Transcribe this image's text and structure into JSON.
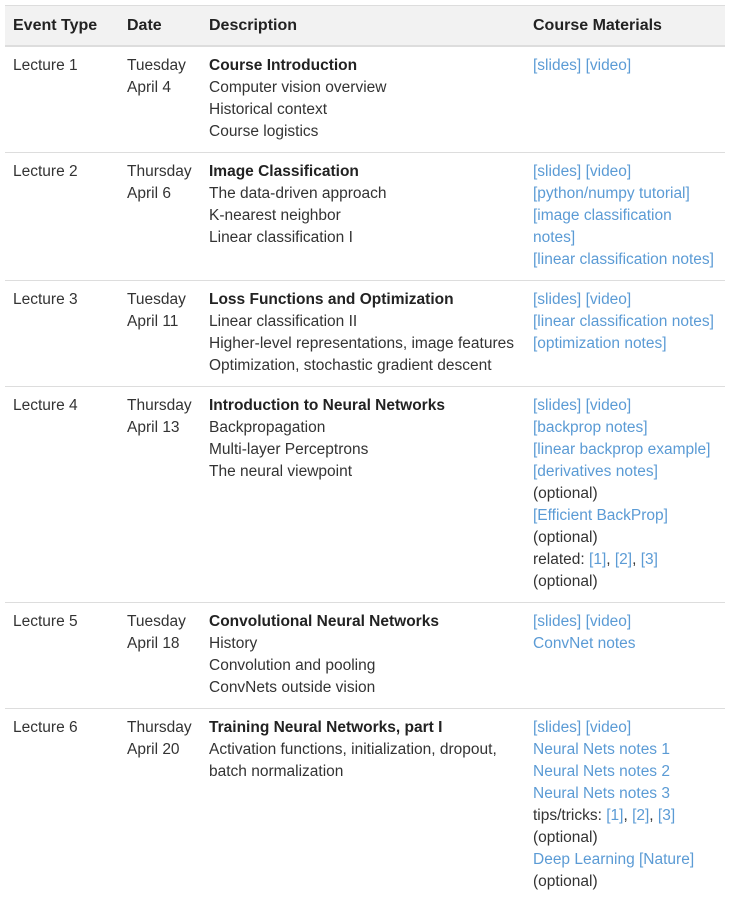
{
  "headers": {
    "event_type": "Event Type",
    "date": "Date",
    "description": "Description",
    "materials": "Course Materials"
  },
  "rows": [
    {
      "event": "Lecture 1",
      "date_line1": "Tuesday",
      "date_line2": "April 4",
      "title": "Course Introduction",
      "topics": [
        "Computer vision overview",
        "Historical context",
        "Course logistics"
      ],
      "materials": {
        "slides": "[slides]",
        "video": "[video]"
      }
    },
    {
      "event": "Lecture 2",
      "date_line1": "Thursday",
      "date_line2": "April 6",
      "title": "Image Classification",
      "topics": [
        "The data-driven approach",
        "K-nearest neighbor",
        "Linear classification I"
      ],
      "materials": {
        "slides": "[slides]",
        "video": "[video]",
        "python_tutorial": "[python/numpy tutorial]",
        "image_classification_notes": "[image classification notes]",
        "linear_classification_notes": "[linear classification notes]"
      }
    },
    {
      "event": "Lecture 3",
      "date_line1": "Tuesday",
      "date_line2": "April 11",
      "title": "Loss Functions and Optimization",
      "topics": [
        "Linear classification II",
        "Higher-level representations, image features",
        "Optimization, stochastic gradient descent"
      ],
      "materials": {
        "slides": "[slides]",
        "video": "[video]",
        "linear_classification_notes": "[linear classification notes]",
        "optimization_notes": "[optimization notes]"
      }
    },
    {
      "event": "Lecture 4",
      "date_line1": "Thursday",
      "date_line2": "April 13",
      "title": "Introduction to Neural Networks",
      "topics": [
        "Backpropagation",
        "Multi-layer Perceptrons",
        "The neural viewpoint"
      ],
      "materials": {
        "slides": "[slides]",
        "video": "[video]",
        "backprop_notes": "[backprop notes]",
        "linear_backprop_example": "[linear backprop example]",
        "derivatives_notes": "[derivatives notes]",
        "optional1": "(optional)",
        "efficient_backprop": "[Efficient BackProp]",
        "optional2": "(optional)",
        "related_label": "related: ",
        "ref1": "[1]",
        "ref2": "[2]",
        "ref3": "[3]",
        "sep": ", ",
        "optional3": "(optional)"
      }
    },
    {
      "event": "Lecture 5",
      "date_line1": "Tuesday",
      "date_line2": "April 18",
      "title": "Convolutional Neural Networks",
      "topics": [
        "History",
        "Convolution and pooling",
        "ConvNets outside vision"
      ],
      "materials": {
        "slides": "[slides]",
        "video": "[video]",
        "convnet_notes": "ConvNet notes"
      }
    },
    {
      "event": "Lecture 6",
      "date_line1": "Thursday",
      "date_line2": "April 20",
      "title": "Training Neural Networks, part I",
      "topics": [
        "Activation functions, initialization, dropout,",
        "batch normalization"
      ],
      "materials": {
        "slides": "[slides]",
        "video": "[video]",
        "nn_notes_1": "Neural Nets notes 1",
        "nn_notes_2": "Neural Nets notes 2",
        "nn_notes_3": "Neural Nets notes 3",
        "tips_label": "tips/tricks: ",
        "ref1": "[1]",
        "ref2": "[2]",
        "ref3": "[3]",
        "sep": ", ",
        "optional1": "(optional)",
        "deep_learning": "Deep Learning [Nature]",
        "optional2": "(optional)"
      }
    }
  ]
}
